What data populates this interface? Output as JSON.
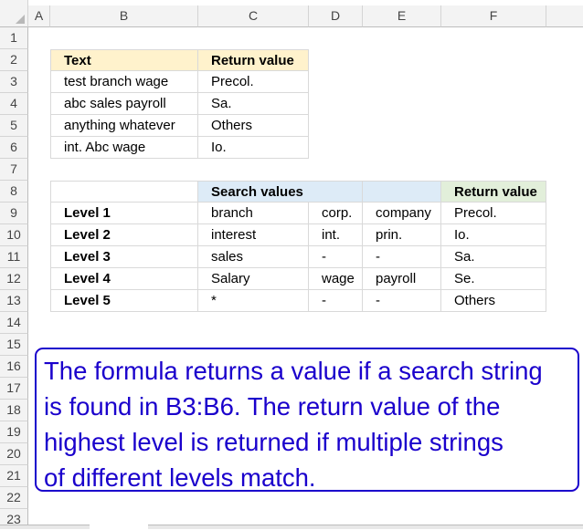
{
  "columns": [
    "A",
    "B",
    "C",
    "D",
    "E",
    "F"
  ],
  "rows": [
    "1",
    "2",
    "3",
    "4",
    "5",
    "6",
    "7",
    "8",
    "9",
    "10",
    "11",
    "12",
    "13",
    "14",
    "15",
    "16",
    "17",
    "18",
    "19",
    "20",
    "21",
    "22",
    "23"
  ],
  "table1": {
    "header": {
      "text": "Text",
      "return_value": "Return value"
    },
    "rows": [
      {
        "text": "test branch wage",
        "return_value": "Precol."
      },
      {
        "text": "abc sales payroll",
        "return_value": "Sa."
      },
      {
        "text": "anything whatever",
        "return_value": "Others"
      },
      {
        "text": "int. Abc wage",
        "return_value": "Io."
      }
    ]
  },
  "table2": {
    "header": {
      "search_values": "Search values",
      "return_value": "Return value"
    },
    "rows": [
      {
        "level": "Level 1",
        "v1": "branch",
        "v2": "corp.",
        "v3": "company",
        "ret": "Precol."
      },
      {
        "level": "Level 2",
        "v1": "interest",
        "v2": "int.",
        "v3": "prin.",
        "ret": "Io."
      },
      {
        "level": "Level 3",
        "v1": "sales",
        "v2": "-",
        "v3": "-",
        "ret": "Sa."
      },
      {
        "level": "Level 4",
        "v1": "Salary",
        "v2": "wage",
        "v3": "payroll",
        "ret": "Se."
      },
      {
        "level": "Level 5",
        "v1": "*",
        "v2": "-",
        "v3": "-",
        "ret": "Others"
      }
    ]
  },
  "note": {
    "line1": "The formula returns a value if a search string",
    "line2": "is found in B3:B6. The return value of the",
    "line3": "highest level is returned if multiple strings",
    "line4": "of different levels match."
  },
  "colors": {
    "header_yellow": "#fff2cc",
    "header_blue": "#ddebf7",
    "header_green": "#e2efda",
    "note_blue": "#1a00cc"
  }
}
